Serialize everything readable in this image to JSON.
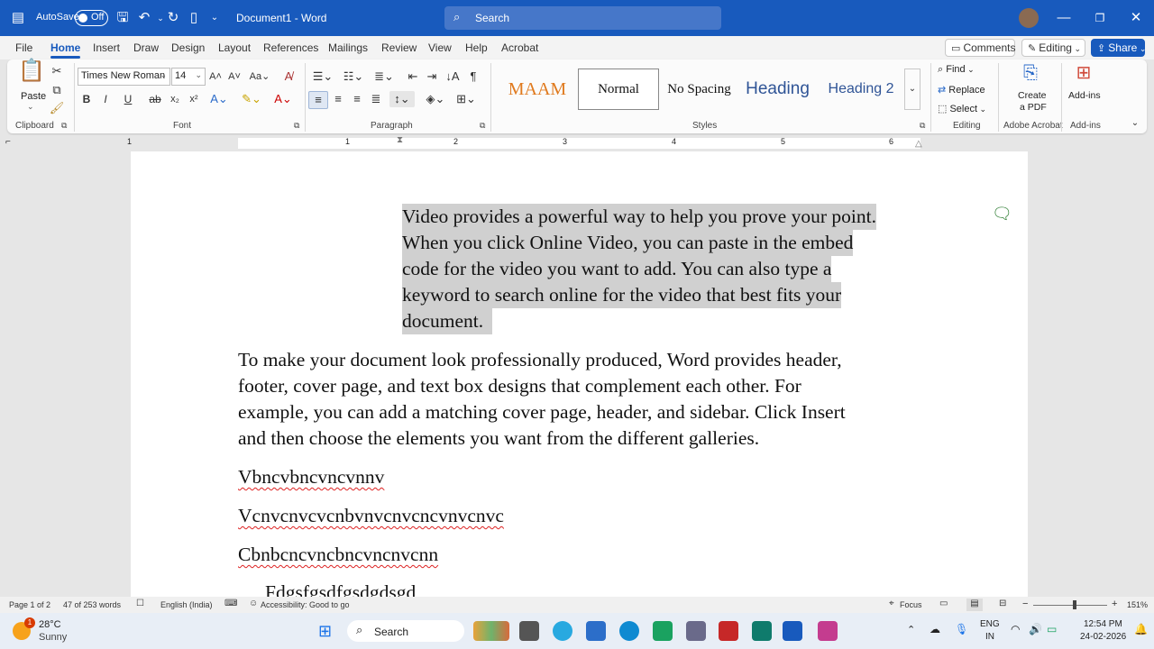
{
  "titlebar": {
    "autosave_label": "AutoSave",
    "toggle_state": "Off",
    "doc_title": "Document1 - Word",
    "search_placeholder": "Search"
  },
  "menu": {
    "items": [
      "File",
      "Home",
      "Insert",
      "Draw",
      "Design",
      "Layout",
      "References",
      "Mailings",
      "Review",
      "View",
      "Help",
      "Acrobat"
    ],
    "comments": "Comments",
    "editing": "Editing",
    "share": "Share"
  },
  "ribbon": {
    "paste": "Paste",
    "font_name": "Times New Roman",
    "font_size": "14",
    "styles": [
      "MAAM",
      "Normal",
      "No Spacing",
      "Heading",
      "Heading 2"
    ],
    "find": "Find",
    "replace": "Replace",
    "select": "Select",
    "create_pdf_1": "Create",
    "create_pdf_2": "a PDF",
    "addins": "Add-ins",
    "groups": {
      "clipboard": "Clipboard",
      "font": "Font",
      "paragraph": "Paragraph",
      "styles": "Styles",
      "editing": "Editing",
      "acrobat": "Adobe Acrobat",
      "addins": "Add-ins"
    }
  },
  "ruler": {
    "numbers": [
      "1",
      "1",
      "2",
      "3",
      "4",
      "5",
      "6"
    ]
  },
  "document": {
    "para1": [
      "Video provides a powerful way to help you prove your point.",
      "When you click Online Video, you can paste in the embed",
      "code for the video you want to add. You can also type a",
      "keyword to search online for the video that best fits your",
      "document."
    ],
    "para2": [
      "To make your document look professionally produced, Word provides header,",
      "footer, cover page, and text box designs that complement each other. For",
      "example, you can add a matching cover page, header, and sidebar. Click Insert",
      "and then choose the elements you want from the different galleries."
    ],
    "line3": "Vbncvbncvncvnnv",
    "line4": "Vcnvcnvcvcnbvnvcnvcncvnvcnvc",
    "line5": "Cbnbcncvncbncvncnvcnn",
    "line6": "Fdgsfgsdfgsdgdsgd"
  },
  "status": {
    "page": "Page 1 of 2",
    "words": "47 of 253 words",
    "language": "English (India)",
    "accessibility": "Accessibility: Good to go",
    "focus": "Focus",
    "zoom": "151%"
  },
  "taskbar": {
    "temp": "28°C",
    "weather": "Sunny",
    "badge": "1",
    "search": "Search",
    "lang1": "ENG",
    "lang2": "IN",
    "time": "12:54 PM",
    "date": "24-02-2026"
  },
  "colors": {
    "brand": "#185abd",
    "selection": "#d0d0d0",
    "maam": "#e07a1e",
    "heading": "#2f5496"
  }
}
